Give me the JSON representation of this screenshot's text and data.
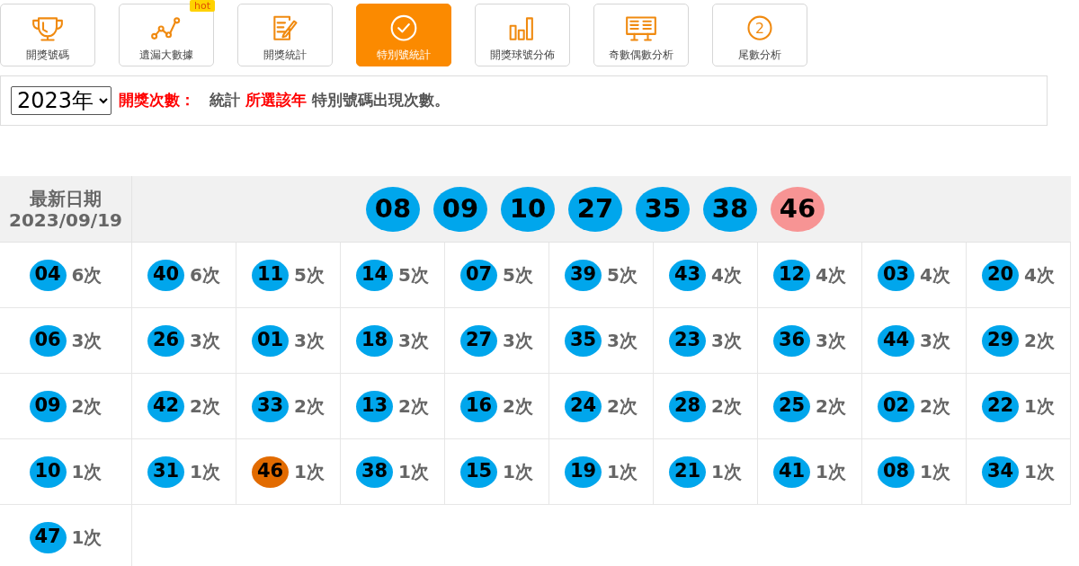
{
  "tabs": [
    {
      "label": "開獎號碼",
      "selected": false
    },
    {
      "label": "遺漏大數據",
      "selected": false,
      "badge": "hot"
    },
    {
      "label": "開獎統計",
      "selected": false
    },
    {
      "label": "特別號統計",
      "selected": true
    },
    {
      "label": "開獎球號分佈",
      "selected": false
    },
    {
      "label": "奇數偶數分析",
      "selected": false
    },
    {
      "label": "尾數分析",
      "selected": false,
      "icon_text": "2"
    }
  ],
  "filter": {
    "year": "2023年",
    "label": "開獎次數：",
    "text_1": "統計",
    "text_highlight": "所選該年",
    "text_2": "特別號碼出現次數。"
  },
  "latest": {
    "label": "最新日期",
    "date": "2023/09/19",
    "balls": [
      {
        "number": "08",
        "kind": "normal"
      },
      {
        "number": "09",
        "kind": "normal"
      },
      {
        "number": "10",
        "kind": "normal"
      },
      {
        "number": "27",
        "kind": "normal"
      },
      {
        "number": "35",
        "kind": "normal"
      },
      {
        "number": "38",
        "kind": "normal"
      },
      {
        "number": "46",
        "kind": "special"
      }
    ]
  },
  "stats": [
    {
      "number": "04",
      "count": "6次",
      "highlighted": false
    },
    {
      "number": "40",
      "count": "6次",
      "highlighted": false
    },
    {
      "number": "11",
      "count": "5次",
      "highlighted": false
    },
    {
      "number": "14",
      "count": "5次",
      "highlighted": false
    },
    {
      "number": "07",
      "count": "5次",
      "highlighted": false
    },
    {
      "number": "39",
      "count": "5次",
      "highlighted": false
    },
    {
      "number": "43",
      "count": "4次",
      "highlighted": false
    },
    {
      "number": "12",
      "count": "4次",
      "highlighted": false
    },
    {
      "number": "03",
      "count": "4次",
      "highlighted": false
    },
    {
      "number": "20",
      "count": "4次",
      "highlighted": false
    },
    {
      "number": "06",
      "count": "3次",
      "highlighted": false
    },
    {
      "number": "26",
      "count": "3次",
      "highlighted": false
    },
    {
      "number": "01",
      "count": "3次",
      "highlighted": false
    },
    {
      "number": "18",
      "count": "3次",
      "highlighted": false
    },
    {
      "number": "27",
      "count": "3次",
      "highlighted": false
    },
    {
      "number": "35",
      "count": "3次",
      "highlighted": false
    },
    {
      "number": "23",
      "count": "3次",
      "highlighted": false
    },
    {
      "number": "36",
      "count": "3次",
      "highlighted": false
    },
    {
      "number": "44",
      "count": "3次",
      "highlighted": false
    },
    {
      "number": "29",
      "count": "2次",
      "highlighted": false
    },
    {
      "number": "09",
      "count": "2次",
      "highlighted": false
    },
    {
      "number": "42",
      "count": "2次",
      "highlighted": false
    },
    {
      "number": "33",
      "count": "2次",
      "highlighted": false
    },
    {
      "number": "13",
      "count": "2次",
      "highlighted": false
    },
    {
      "number": "16",
      "count": "2次",
      "highlighted": false
    },
    {
      "number": "24",
      "count": "2次",
      "highlighted": false
    },
    {
      "number": "28",
      "count": "2次",
      "highlighted": false
    },
    {
      "number": "25",
      "count": "2次",
      "highlighted": false
    },
    {
      "number": "02",
      "count": "2次",
      "highlighted": false
    },
    {
      "number": "22",
      "count": "1次",
      "highlighted": false
    },
    {
      "number": "10",
      "count": "1次",
      "highlighted": false
    },
    {
      "number": "31",
      "count": "1次",
      "highlighted": false
    },
    {
      "number": "46",
      "count": "1次",
      "highlighted": true
    },
    {
      "number": "38",
      "count": "1次",
      "highlighted": false
    },
    {
      "number": "15",
      "count": "1次",
      "highlighted": false
    },
    {
      "number": "19",
      "count": "1次",
      "highlighted": false
    },
    {
      "number": "21",
      "count": "1次",
      "highlighted": false
    },
    {
      "number": "41",
      "count": "1次",
      "highlighted": false
    },
    {
      "number": "08",
      "count": "1次",
      "highlighted": false
    },
    {
      "number": "34",
      "count": "1次",
      "highlighted": false
    },
    {
      "number": "47",
      "count": "1次",
      "highlighted": false
    }
  ]
}
